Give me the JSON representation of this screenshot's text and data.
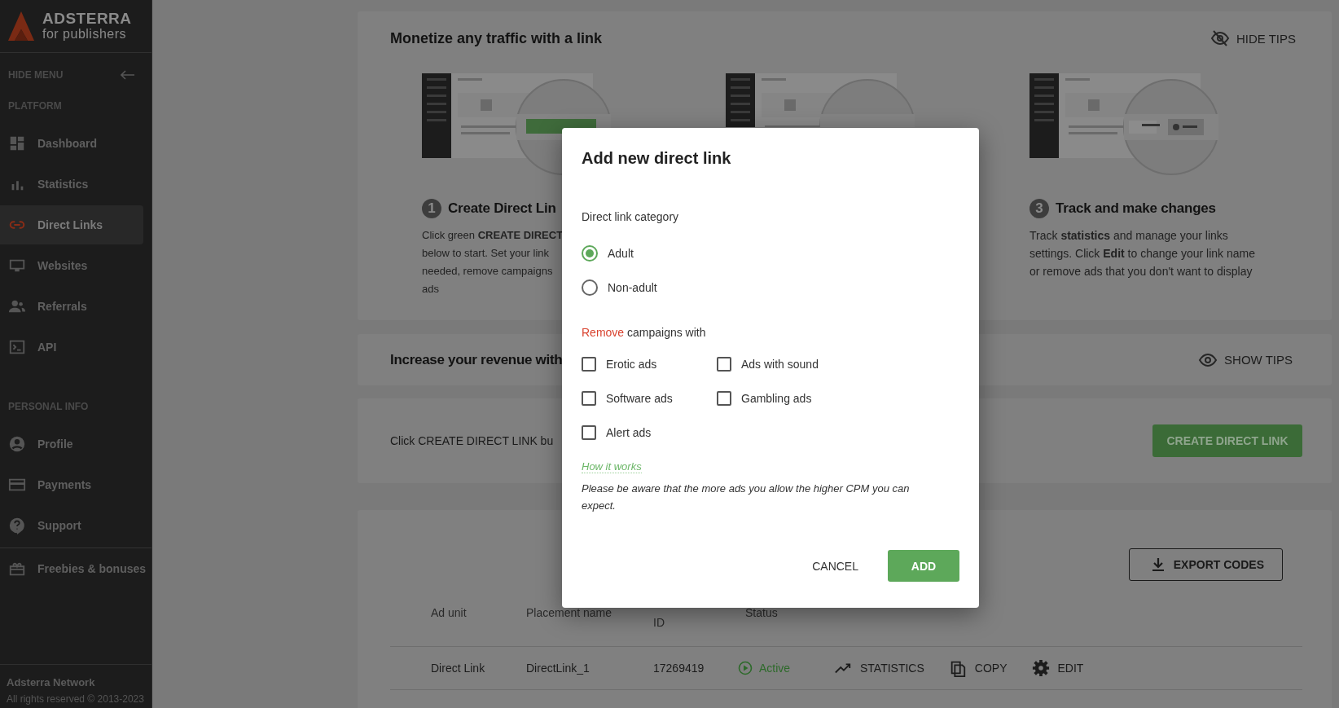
{
  "sidebar": {
    "logo": {
      "name": "ADSTERRA",
      "tagline": "for publishers"
    },
    "hide_menu": "HIDE MENU",
    "sections": [
      {
        "title": "PLATFORM",
        "items": [
          {
            "label": "Dashboard",
            "selected": false
          },
          {
            "label": "Statistics",
            "selected": false
          },
          {
            "label": "Direct Links",
            "selected": true
          },
          {
            "label": "Websites",
            "selected": false
          },
          {
            "label": "Referrals",
            "selected": false
          },
          {
            "label": "API",
            "selected": false
          }
        ]
      },
      {
        "title": "PERSONAL INFO",
        "items": [
          {
            "label": "Profile",
            "selected": false
          },
          {
            "label": "Payments",
            "selected": false
          },
          {
            "label": "Support",
            "selected": false
          }
        ]
      }
    ],
    "extra_items": [
      {
        "label": "Freebies & bonuses",
        "selected": false
      }
    ],
    "footer": {
      "company": "Adsterra Network",
      "copyright": "All rights reserved © 2013-2023"
    }
  },
  "tips_card": {
    "title": "Monetize any traffic with a link",
    "toggle": "HIDE TIPS",
    "steps": [
      {
        "kind": "create",
        "number": "1",
        "title": "Create Direct Lin",
        "lines": [
          "Click green **CREATE DIRECT**",
          "below to start. Set your link",
          "needed, remove campaigns",
          "ads"
        ]
      },
      {
        "kind": "blank"
      },
      {
        "kind": "edit",
        "number": "3",
        "title": "Track and make changes",
        "text": "Track **statistics** and manage your links settings. Click **Edit** to change your link name or remove ads that you don't want to display"
      }
    ]
  },
  "revenue_card": {
    "title": "Increase your revenue with",
    "toggle": "SHOW TIPS"
  },
  "create_card": {
    "text": "Click CREATE DIRECT LINK bu",
    "button": "CREATE DIRECT LINK"
  },
  "links_table": {
    "export_button": "EXPORT CODES",
    "columns": [
      "Ad unit",
      "Placement name",
      "ID",
      "Status"
    ],
    "rows": [
      {
        "ad_unit": "Direct Link",
        "placement_name": "DirectLink_1",
        "id": "17269419",
        "status": "Active",
        "actions": [
          "STATISTICS",
          "COPY",
          "EDIT"
        ]
      }
    ]
  },
  "dialog": {
    "title": "Add new direct link",
    "category_label": "Direct link category",
    "categories": [
      {
        "label": "Adult",
        "selected": true
      },
      {
        "label": "Non-adult",
        "selected": false
      }
    ],
    "remove_heading": {
      "highlight": "Remove",
      "rest": "campaigns with"
    },
    "options": [
      {
        "label": "Erotic ads",
        "checked": false
      },
      {
        "label": "Ads with sound",
        "checked": false
      },
      {
        "label": "Software ads",
        "checked": false
      },
      {
        "label": "Gambling ads",
        "checked": false
      },
      {
        "label": "Alert ads",
        "checked": false
      }
    ],
    "help_link": "How it works",
    "note": "Please be aware that the more ads you allow the higher CPM you can expect.",
    "cancel_button": "CANCEL",
    "add_button": "ADD"
  }
}
